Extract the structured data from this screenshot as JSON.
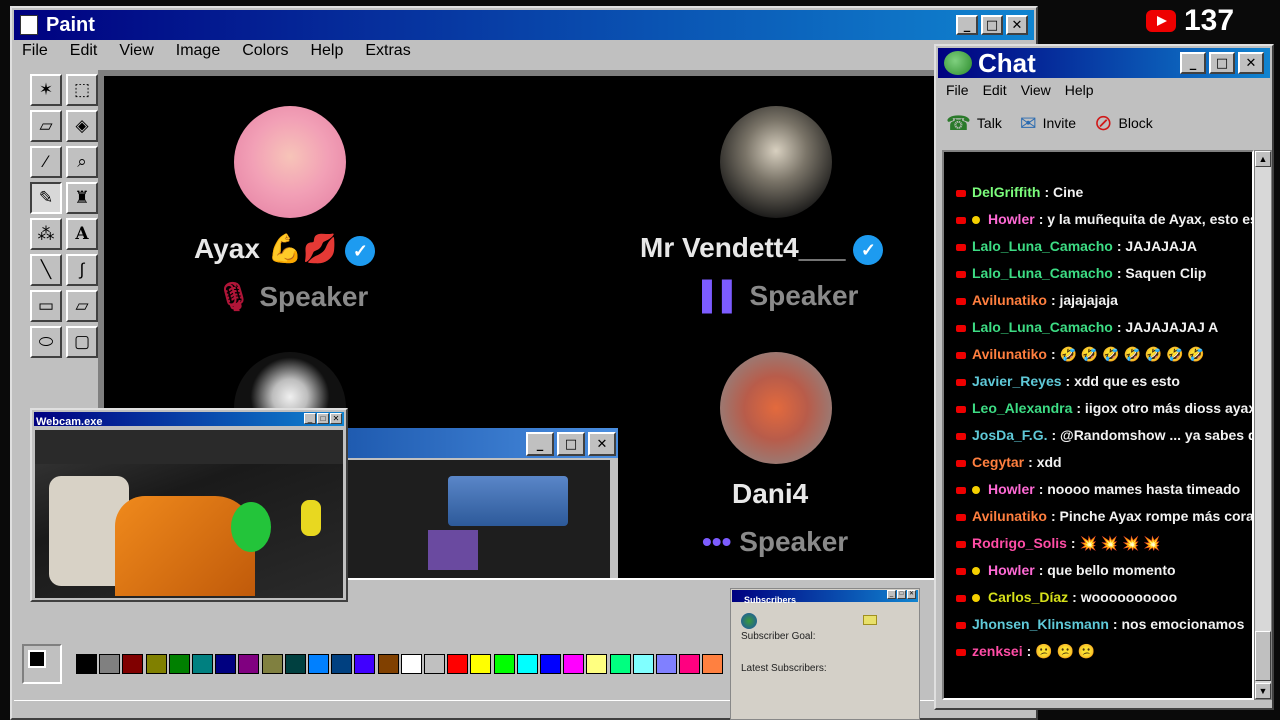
{
  "youtube": {
    "viewers": "137"
  },
  "paint": {
    "title": "Paint",
    "menu": [
      "File",
      "Edit",
      "View",
      "Image",
      "Colors",
      "Help",
      "Extras"
    ],
    "canvas": {
      "speakers": [
        {
          "name": "Ayax",
          "role": "Speaker"
        },
        {
          "name": "Mr Vendett4___",
          "role": "Speaker"
        },
        {
          "name": "Dani4",
          "role": "Speaker"
        }
      ]
    },
    "palette": [
      "#000000",
      "#808080",
      "#800000",
      "#808000",
      "#008000",
      "#008080",
      "#000080",
      "#800080",
      "#808040",
      "#004040",
      "#0080ff",
      "#004080",
      "#4000ff",
      "#804000",
      "#ffffff",
      "#c0c0c0",
      "#ff0000",
      "#ffff00",
      "#00ff00",
      "#00ffff",
      "#0000ff",
      "#ff00ff",
      "#ffff80",
      "#00ff80",
      "#80ffff",
      "#8080ff",
      "#ff0080",
      "#ff8040"
    ]
  },
  "webcam": {
    "title": "Webcam.exe"
  },
  "subscribers": {
    "title": "Subscribers",
    "goal_label": "Subscriber Goal:",
    "latest_label": "Latest Subscribers:"
  },
  "chat": {
    "title": "Chat",
    "menu": [
      "File",
      "Edit",
      "View",
      "Help"
    ],
    "toolbar": {
      "talk": "Talk",
      "invite": "Invite",
      "block": "Block"
    },
    "messages": [
      {
        "user": "DelGriffith",
        "color": "#7cfc7c",
        "text": ": Cine",
        "badge": false
      },
      {
        "user": "Howler",
        "color": "#ff6ad5",
        "text": ": y la muñequita de Ayax, esto es muy",
        "badge": true
      },
      {
        "user": "Lalo_Luna_Camacho",
        "color": "#3ddc84",
        "text": ": JAJAJAJA",
        "badge": false
      },
      {
        "user": "Lalo_Luna_Camacho",
        "color": "#3ddc84",
        "text": ": Saquen Clip",
        "badge": false
      },
      {
        "user": "Avilunatiko",
        "color": "#ff7f3f",
        "text": ": jajajajaja",
        "badge": false
      },
      {
        "user": "Lalo_Luna_Camacho",
        "color": "#3ddc84",
        "text": ": JAJAJAJAJ A",
        "badge": false
      },
      {
        "user": "Avilunatiko",
        "color": "#ff7f3f",
        "text": ": 🤣 🤣 🤣 🤣 🤣 🤣 🤣",
        "badge": false
      },
      {
        "user": "Javier_Reyes",
        "color": "#5fc9d8",
        "text": ": xdd que es esto",
        "badge": false
      },
      {
        "user": "Leo_Alexandra",
        "color": "#3ddc84",
        "text": ": iigox otro más dioss ayax ya pa",
        "badge": false
      },
      {
        "user": "JosDa_F.G.",
        "color": "#5fc9d8",
        "text": ": @Randomshow ... ya sabes que ha",
        "badge": false
      },
      {
        "user": "Cegytar",
        "color": "#ff7f3f",
        "text": ": xdd",
        "badge": false
      },
      {
        "user": "Howler",
        "color": "#ff6ad5",
        "text": ": noooo mames hasta timeado",
        "badge": true
      },
      {
        "user": "Avilunatiko",
        "color": "#ff7f3f",
        "text": ": Pinche Ayax rompe más corazones",
        "badge": false
      },
      {
        "user": "Rodrigo_Solis",
        "color": "#ff4da6",
        "text": ": 💥 💥 💥 💥",
        "badge": false
      },
      {
        "user": "Howler",
        "color": "#ff6ad5",
        "text": ": que bello momento",
        "badge": true
      },
      {
        "user": "Carlos_Díaz",
        "color": "#d6e01a",
        "text": ": woooooooooo",
        "badge": true
      },
      {
        "user": "Jhonsen_Klinsmann",
        "color": "#5fc9d8",
        "text": ": nos emocionamos",
        "badge": false
      },
      {
        "user": "zenksei",
        "color": "#ff4da6",
        "text": ": 😕 😕 😕",
        "badge": false
      }
    ]
  }
}
